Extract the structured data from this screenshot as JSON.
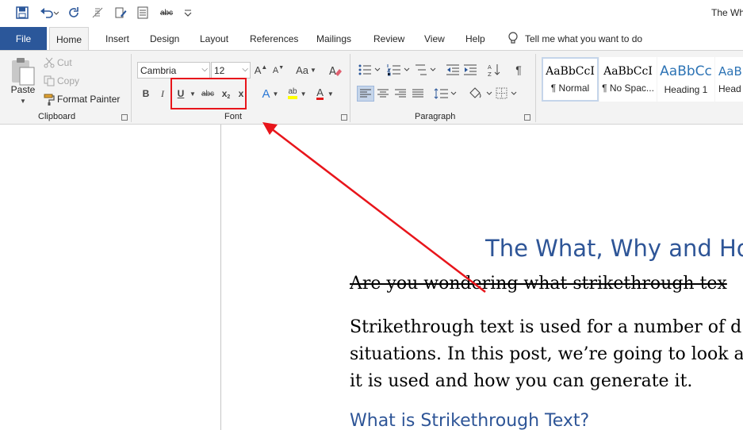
{
  "window": {
    "title": "The Wh"
  },
  "qat": {
    "icons": [
      "save-icon",
      "undo-icon",
      "redo-icon",
      "document-icon",
      "edit-icon",
      "page-icon",
      "strikethrough-icon",
      "customize-icon"
    ],
    "strikethrough_label": "abc"
  },
  "tabs": {
    "file": "File",
    "items": [
      "Home",
      "Insert",
      "Design",
      "Layout",
      "References",
      "Mailings",
      "Review",
      "View",
      "Help"
    ],
    "active": "Home",
    "tell_me": "Tell me what you want to do"
  },
  "ribbon": {
    "clipboard": {
      "label": "Clipboard",
      "paste": "Paste",
      "cut": "Cut",
      "copy": "Copy",
      "format_painter": "Format Painter"
    },
    "font": {
      "label": "Font",
      "font_name": "Cambria",
      "font_size": "12",
      "grow": "A",
      "shrink": "A",
      "change_case": "Aa",
      "bold": "B",
      "italic": "I",
      "underline": "U",
      "strikethrough": "abc",
      "subscript": "x",
      "subscript_mark": "2",
      "superscript": "x",
      "text_effects": "A",
      "highlight": "ab",
      "font_color": "A"
    },
    "paragraph": {
      "label": "Paragraph",
      "pilcrow": "¶"
    },
    "styles": [
      {
        "sample": "AaBbCcI",
        "name": "¶ Normal"
      },
      {
        "sample": "AaBbCcI",
        "name": "¶ No Spac..."
      },
      {
        "sample": "AaBbCc",
        "name": "Heading 1"
      },
      {
        "sample": "AaBb",
        "name": "Head"
      }
    ]
  },
  "document": {
    "heading": "The What, Why and Ho",
    "strike_line": "Are you wondering what strikethrough tex",
    "paragraph_lines": [
      "Strikethrough text is used for a number of d",
      "situations. In this post, we’re going to look a",
      "it is used and how you can generate it."
    ],
    "subheading": "What is Strikethrough Text?"
  },
  "colors": {
    "file_tab": "#2b579a",
    "heading": "#2e5597",
    "annotation": "#e8151b",
    "ribbon_bg": "#f3f3f3"
  }
}
